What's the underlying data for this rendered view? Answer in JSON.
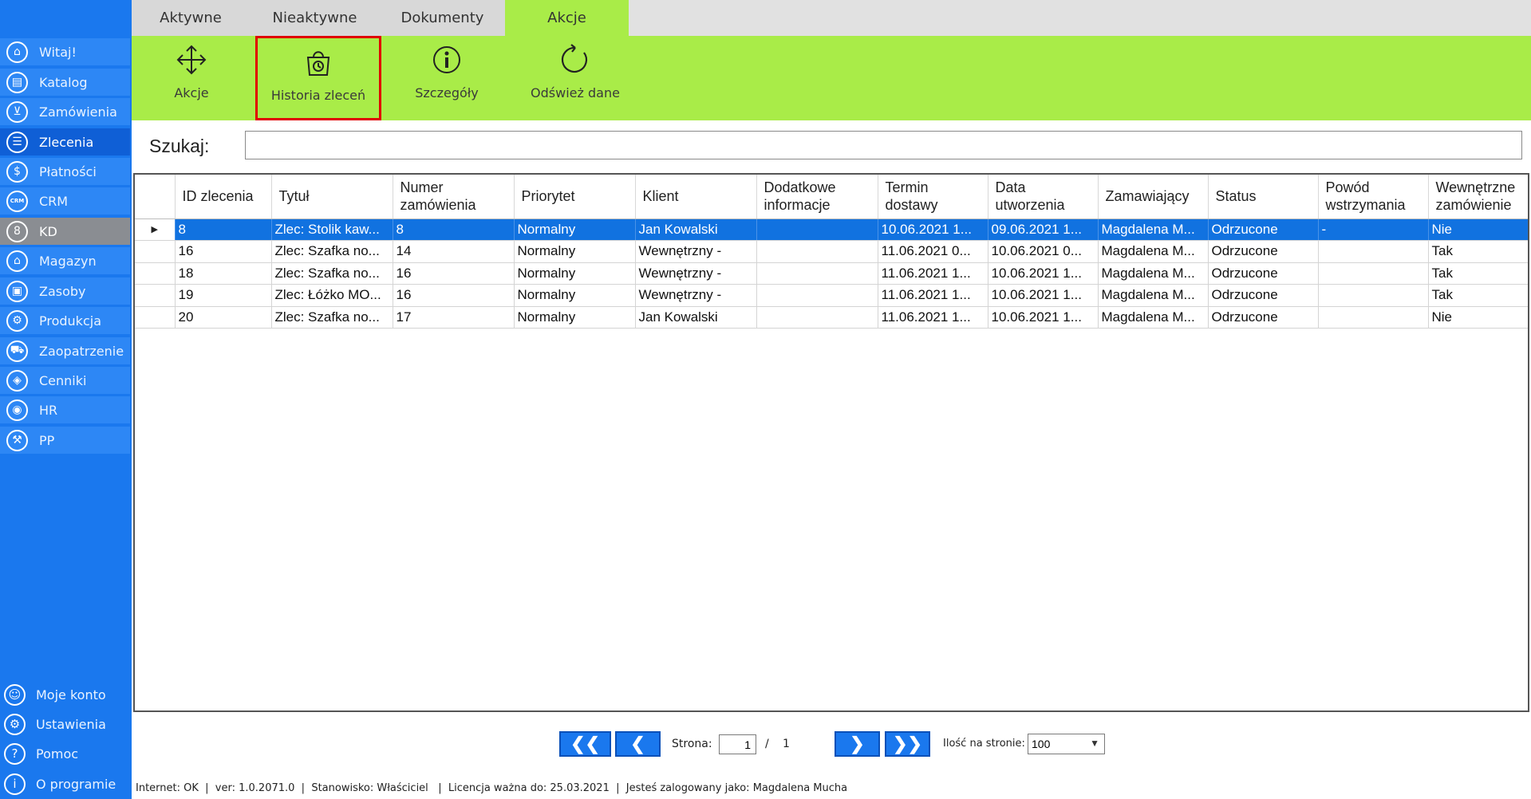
{
  "sidebar": {
    "items": [
      {
        "label": "Witaj!",
        "icon": "home-icon",
        "glyph": "⌂"
      },
      {
        "label": "Katalog",
        "icon": "book-icon",
        "glyph": "▤"
      },
      {
        "label": "Zamówienia",
        "icon": "cart-icon",
        "glyph": "⊻"
      },
      {
        "label": "Zlecenia",
        "icon": "list-icon",
        "glyph": "☰"
      },
      {
        "label": "Płatności",
        "icon": "dollar-icon",
        "glyph": "$"
      },
      {
        "label": "CRM",
        "icon": "crm-icon",
        "glyph": "CRM"
      },
      {
        "label": "KD",
        "icon": "person-icon",
        "glyph": "8"
      },
      {
        "label": "Magazyn",
        "icon": "warehouse-icon",
        "glyph": "⌂"
      },
      {
        "label": "Zasoby",
        "icon": "resources-icon",
        "glyph": "▣"
      },
      {
        "label": "Produkcja",
        "icon": "production-icon",
        "glyph": "⚙"
      },
      {
        "label": "Zaopatrzenie",
        "icon": "truck-icon",
        "glyph": "⛟"
      },
      {
        "label": "Cenniki",
        "icon": "tag-icon",
        "glyph": "◈"
      },
      {
        "label": "HR",
        "icon": "hr-icon",
        "glyph": "◉"
      },
      {
        "label": "PP",
        "icon": "pp-icon",
        "glyph": "⚒"
      }
    ],
    "bottom": [
      {
        "label": "Moje konto",
        "icon": "account-icon",
        "glyph": "☺"
      },
      {
        "label": "Ustawienia",
        "icon": "settings-icon",
        "glyph": "⚙"
      },
      {
        "label": "Pomoc",
        "icon": "help-icon",
        "glyph": "?"
      },
      {
        "label": "O programie",
        "icon": "info-icon",
        "glyph": "i"
      }
    ]
  },
  "tabs": [
    "Aktywne",
    "Nieaktywne",
    "Dokumenty",
    "Akcje"
  ],
  "ribbon": {
    "buttons": [
      {
        "label": "Akcje",
        "icon": "move-arrows-icon"
      },
      {
        "label": "Historia zleceń",
        "icon": "history-bag-icon"
      },
      {
        "label": "Szczegóły",
        "icon": "info-icon"
      },
      {
        "label": "Odśwież dane",
        "icon": "refresh-icon"
      }
    ]
  },
  "search": {
    "label": "Szukaj:",
    "value": ""
  },
  "table": {
    "columns": [
      "ID zlecenia",
      "Tytuł",
      "Numer zamówienia",
      "Priorytet",
      "Klient",
      "Dodatkowe informacje",
      "Termin dostawy",
      "Data utworzenia",
      "Zamawiający",
      "Status",
      "Powód wstrzymania",
      "Wewnętrzne zamówienie"
    ],
    "rows": [
      [
        "8",
        "Zlec: Stolik kaw...",
        "8",
        "Normalny",
        "Jan Kowalski",
        "",
        "10.06.2021 1...",
        "09.06.2021 1...",
        "Magdalena M...",
        "Odrzucone",
        "-",
        "Nie"
      ],
      [
        "16",
        "Zlec: Szafka no...",
        "14",
        "Normalny",
        "Wewnętrzny -",
        "",
        "11.06.2021 0...",
        "10.06.2021 0...",
        "Magdalena M...",
        "Odrzucone",
        "",
        "Tak"
      ],
      [
        "18",
        "Zlec: Szafka no...",
        "16",
        "Normalny",
        "Wewnętrzny -",
        "",
        "11.06.2021 1...",
        "10.06.2021 1...",
        "Magdalena M...",
        "Odrzucone",
        "",
        "Tak"
      ],
      [
        "19",
        "Zlec: Łóżko MO...",
        "16",
        "Normalny",
        "Wewnętrzny -",
        "",
        "11.06.2021 1...",
        "10.06.2021 1...",
        "Magdalena M...",
        "Odrzucone",
        "",
        "Tak"
      ],
      [
        "20",
        "Zlec: Szafka no...",
        "17",
        "Normalny",
        "Jan Kowalski",
        "",
        "11.06.2021 1...",
        "10.06.2021 1...",
        "Magdalena M...",
        "Odrzucone",
        "",
        "Nie"
      ]
    ],
    "selected_row": 0,
    "row_indicator": "▶"
  },
  "pager": {
    "first": "❮❮",
    "prev": "❮",
    "next": "❯",
    "last": "❯❯",
    "page_label": "Strona:",
    "page_value": "1",
    "separator": "/",
    "total_pages": "1",
    "per_page_label": "Ilość na stronie:",
    "per_page_value": "100"
  },
  "statusbar": "Internet: OK  |  ver: 1.0.2071.0  |  Stanowisko: Właściciel   |  Licencja ważna do: 25.03.2021  |  Jesteś zalogowany jako: Magdalena Mucha",
  "colors": {
    "sidebar": "#1a78ee",
    "ribbon": "#a9ec48",
    "selection": "#1172e0",
    "highlight": "#e00000"
  }
}
